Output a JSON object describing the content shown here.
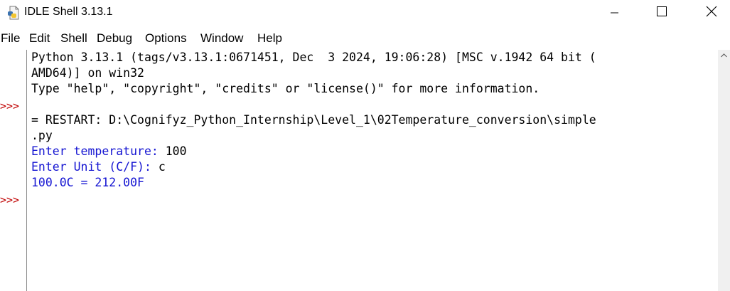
{
  "window": {
    "title": "IDLE Shell 3.13.1",
    "icon": "python-idle-icon"
  },
  "menu": [
    "File",
    "Edit",
    "Shell",
    "Debug",
    "Options",
    "Window",
    "Help"
  ],
  "shell": {
    "prompt": ">>>",
    "banner_line1": "Python 3.13.1 (tags/v3.13.1:0671451, Dec  3 2024, 19:06:28) [MSC v.1942 64 bit (",
    "banner_line2": "AMD64)] on win32",
    "banner_line3": "Type \"help\", \"copyright\", \"credits\" or \"license()\" for more information.",
    "restart_line1": "= RESTART: D:\\Cognifyz_Python_Internship\\Level_1\\02Temperature_conversion\\simple",
    "restart_line2": ".py",
    "out_temp_prompt": "Enter temperature: ",
    "in_temp": "100",
    "out_unit_prompt": "Enter Unit (C/F): ",
    "in_unit": "c",
    "out_result": "100.0C = 212.00F"
  },
  "colors": {
    "prompt": "#c00000",
    "stdout": "#1515d2",
    "text": "#000000"
  }
}
